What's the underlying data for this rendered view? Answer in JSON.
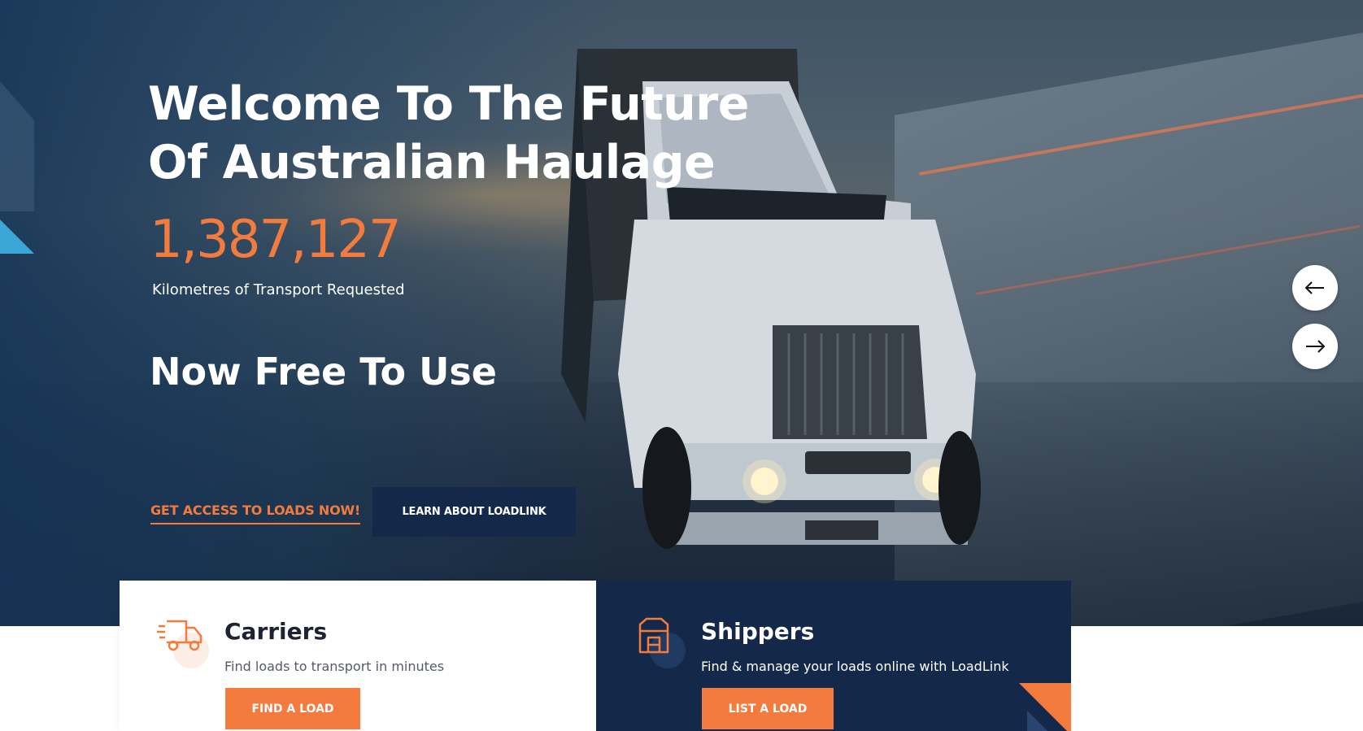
{
  "hero": {
    "title_line1": "Welcome To The Future",
    "title_line2": "Of Australian Haulage",
    "counter_value": "1,387,127",
    "counter_label": "Kilometres of Transport Requested",
    "free_title": "Now Free To Use",
    "access_link_label": "GET ACCESS TO LOADS NOW!",
    "learn_button_label": "LEARN ABOUT LOADLINK"
  },
  "slider": {
    "prev_icon": "arrow-left-icon",
    "next_icon": "arrow-right-icon"
  },
  "cards": {
    "carriers": {
      "icon": "delivery-truck-icon",
      "title": "Carriers",
      "description": "Find loads to transport in minutes",
      "button_label": "FIND A LOAD"
    },
    "shippers": {
      "icon": "package-box-icon",
      "title": "Shippers",
      "description": "Find & manage your loads online with LoadLink",
      "button_label": "LIST A LOAD"
    }
  },
  "colors": {
    "accent": "#f47b3e",
    "navy": "#14284a",
    "white": "#ffffff"
  }
}
